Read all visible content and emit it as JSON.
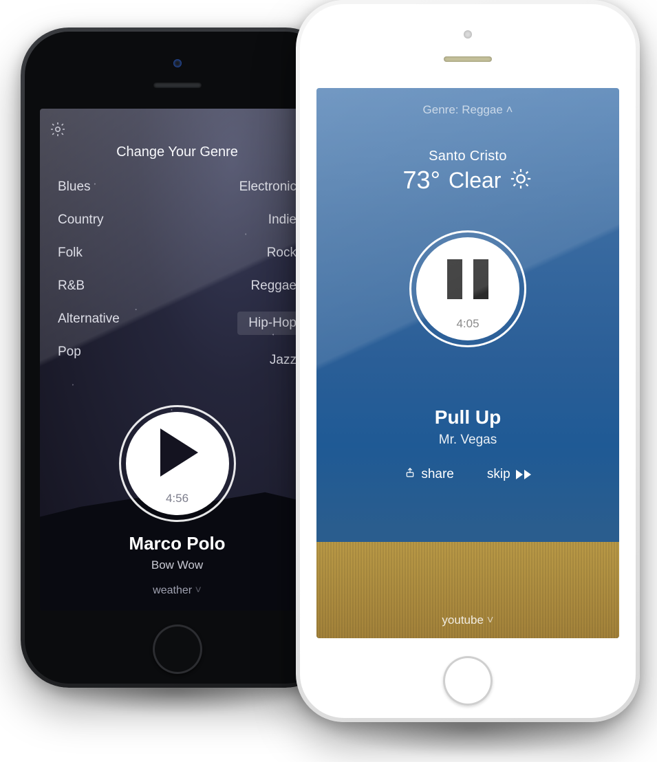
{
  "left": {
    "title": "Change Your Genre",
    "genres_left": [
      "Blues",
      "Country",
      "Folk",
      "R&B",
      "Alternative",
      "Pop"
    ],
    "genres_right": [
      "Electronic",
      "Indie",
      "Rock",
      "Reggae",
      "Hip-Hop",
      "Jazz"
    ],
    "selected_genre": "Hip-Hop",
    "time": "4:56",
    "track_title": "Marco Polo",
    "track_artist": "Bow Wow",
    "footer": "weather"
  },
  "right": {
    "genre_label": "Genre: Reggae",
    "location": "Santo Cristo",
    "temperature": "73°",
    "condition": "Clear",
    "time": "4:05",
    "track_title": "Pull Up",
    "track_artist": "Mr. Vegas",
    "share_label": "share",
    "skip_label": "skip",
    "footer": "youtube"
  }
}
